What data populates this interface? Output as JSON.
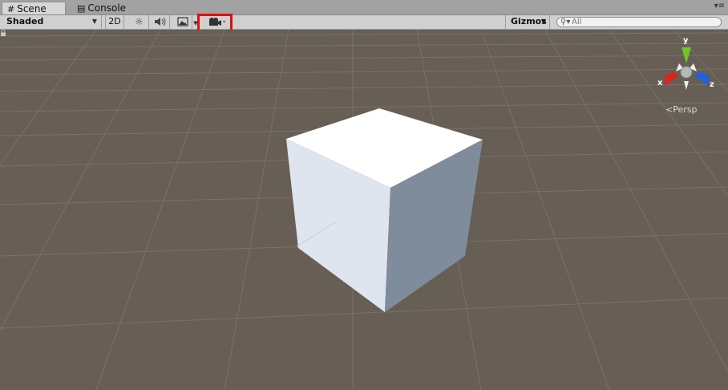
{
  "tabs": {
    "scene_label": "Scene",
    "console_label": "Console",
    "menu_glyph": "▾≡"
  },
  "toolbar": {
    "draw_mode": "Shaded",
    "mode_2d": "2D",
    "gizmos_label": "Gizmos",
    "search_placeholder": "All",
    "icons": [
      "sun-icon",
      "speaker-icon",
      "image-icon",
      "camera-icon"
    ]
  },
  "gizmo": {
    "x_label": "x",
    "y_label": "y",
    "z_label": "z",
    "projection_label": "Persp",
    "colors": {
      "x": "#d02a1e",
      "y": "#6fc624",
      "z": "#2360d8"
    }
  },
  "colors": {
    "viewport_background": "#675e55",
    "highlight": "#e01010"
  }
}
